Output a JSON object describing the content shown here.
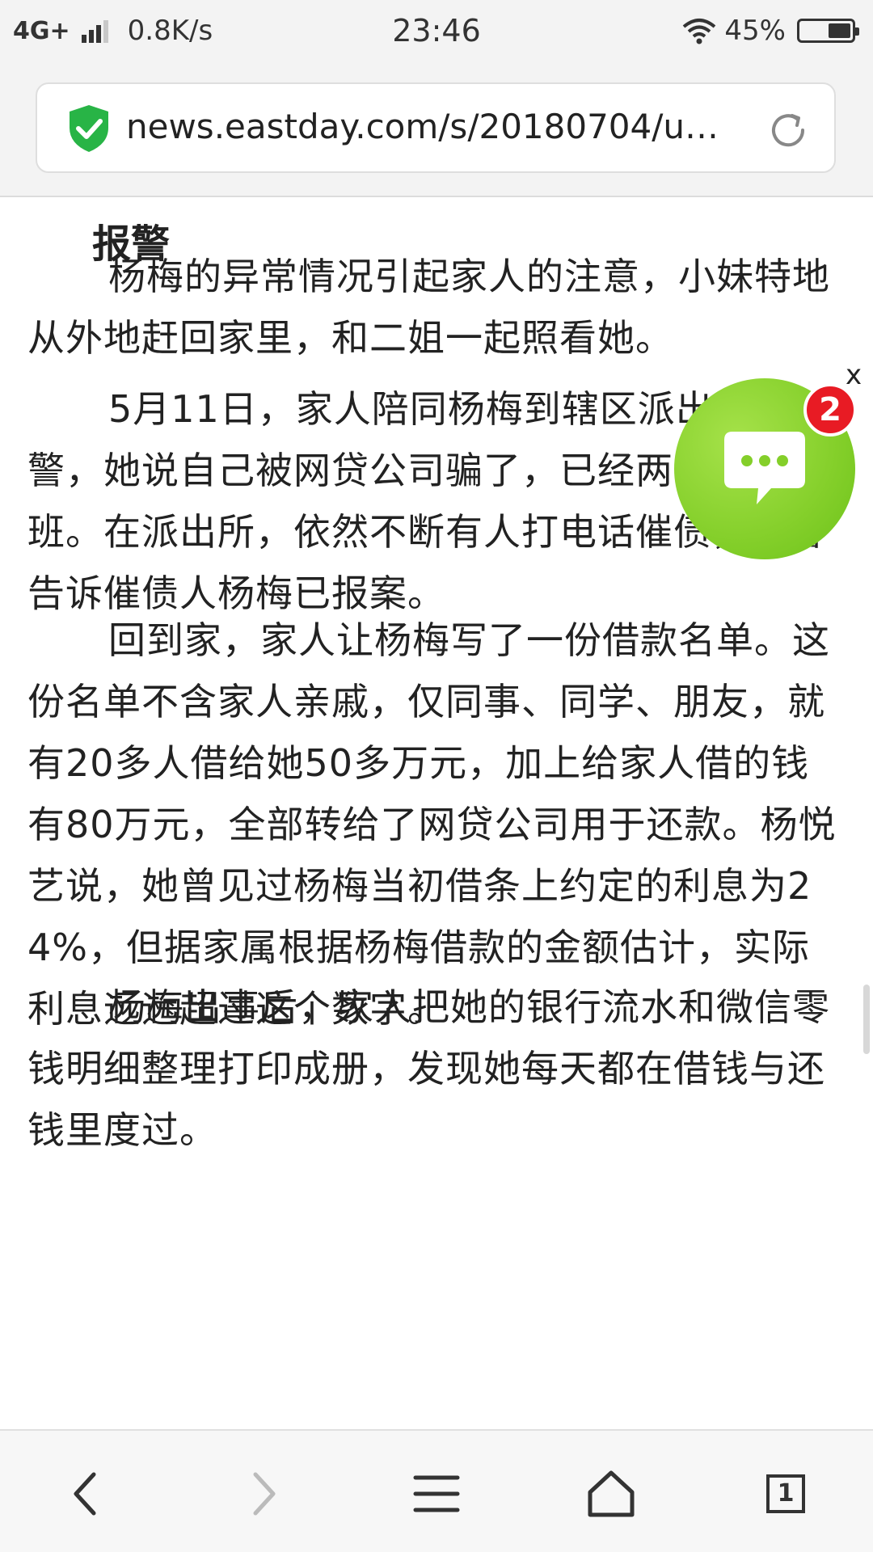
{
  "status_bar": {
    "network_type": "4G+",
    "speed": "0.8K/s",
    "time": "23:46",
    "battery_percent": "45%",
    "battery_level": 0.45
  },
  "browser": {
    "url": "news.eastday.com/s/20180704/u…",
    "secure_icon": "shield-check-icon",
    "refresh_icon": "refresh-icon",
    "secure_color": "#28b446"
  },
  "article": {
    "section_title": "报警",
    "paragraphs": [
      "杨梅的异常情况引起家人的注意，小妹特地从外地赶回家里，和二姐一起照看她。",
      "5月11日，家人陪同杨梅到辖区派出所报警，她说自己被网贷公司骗了，已经两个月没上班。在派出所，依然不断有人打电话催债，民警告诉催债人杨梅已报案。",
      "回到家，家人让杨梅写了一份借款名单。这份名单不含家人亲戚，仅同事、同学、朋友，就有20多人借给她50多万元，加上给家人借的钱有80万元，全部转给了网贷公司用于还款。杨悦艺说，她曾见过杨梅当初借条上约定的利息为24%，但据家属根据杨梅借款的金额估计，实际利息远远超过这个数字。",
      "杨梅出事后，家人把她的银行流水和微信零钱明细整理打印成册，发现她每天都在借钱与还钱里度过。"
    ]
  },
  "chat_widget": {
    "close_label": "x",
    "badge_count": "2",
    "icon": "chat-bubble-icon",
    "color": "#84cf2a",
    "badge_color": "#e81b24"
  },
  "bottom_nav": {
    "back_icon": "back-arrow-icon",
    "forward_icon": "forward-arrow-icon",
    "menu_icon": "menu-icon",
    "home_icon": "home-icon",
    "tabs_count": "1"
  }
}
